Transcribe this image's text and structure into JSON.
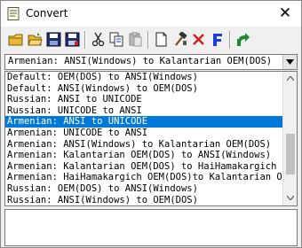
{
  "window": {
    "title": "Convert",
    "close_glyph": "✕"
  },
  "toolbar": {
    "buttons": [
      {
        "name": "new-icon"
      },
      {
        "name": "open-folder-icon"
      },
      {
        "name": "save-icon"
      },
      {
        "name": "save-as-icon"
      },
      {
        "name": "cut-icon"
      },
      {
        "name": "copy-icon"
      },
      {
        "name": "paste-icon"
      },
      {
        "name": "blank-document-icon"
      },
      {
        "name": "hammer-icon"
      },
      {
        "name": "delete-x-icon"
      },
      {
        "name": "font-f-icon"
      },
      {
        "name": "export-arrow-icon"
      }
    ]
  },
  "combo": {
    "selected": "Armenian: ANSI(Windows) to Kalantarian OEM(DOS)"
  },
  "list": {
    "items": [
      "Default: OEM(DOS) to ANSI(Windows)",
      "Default: ANSI(Windows) to OEM(DOS)",
      "Russian: ANSI to UNICODE",
      "Russian: UNICODE to ANSI",
      "Armenian: ANSI to UNICODE",
      "Armenian: UNICODE to ANSI",
      "Armenian: ANSI(Windows) to Kalantarian OEM(DOS)",
      "Armenian: Kalantarian OEM(DOS) to ANSI(Windows)",
      "Armenian: Kalantarian OEM(DOS) to HaiHamakargich",
      "Armenian: HaiHamakargich OEM(DOS)to Kalantarian O",
      "Russian: OEM(DOS) to ANSI(Windows)",
      "Russian: ANSI(Windows) to OEM(DOS)"
    ],
    "selected_index": 4
  },
  "colors": {
    "selection": "#0078d7",
    "accent_red": "#d42020",
    "accent_blue": "#1a3fd6",
    "accent_green": "#1e8a2e"
  }
}
